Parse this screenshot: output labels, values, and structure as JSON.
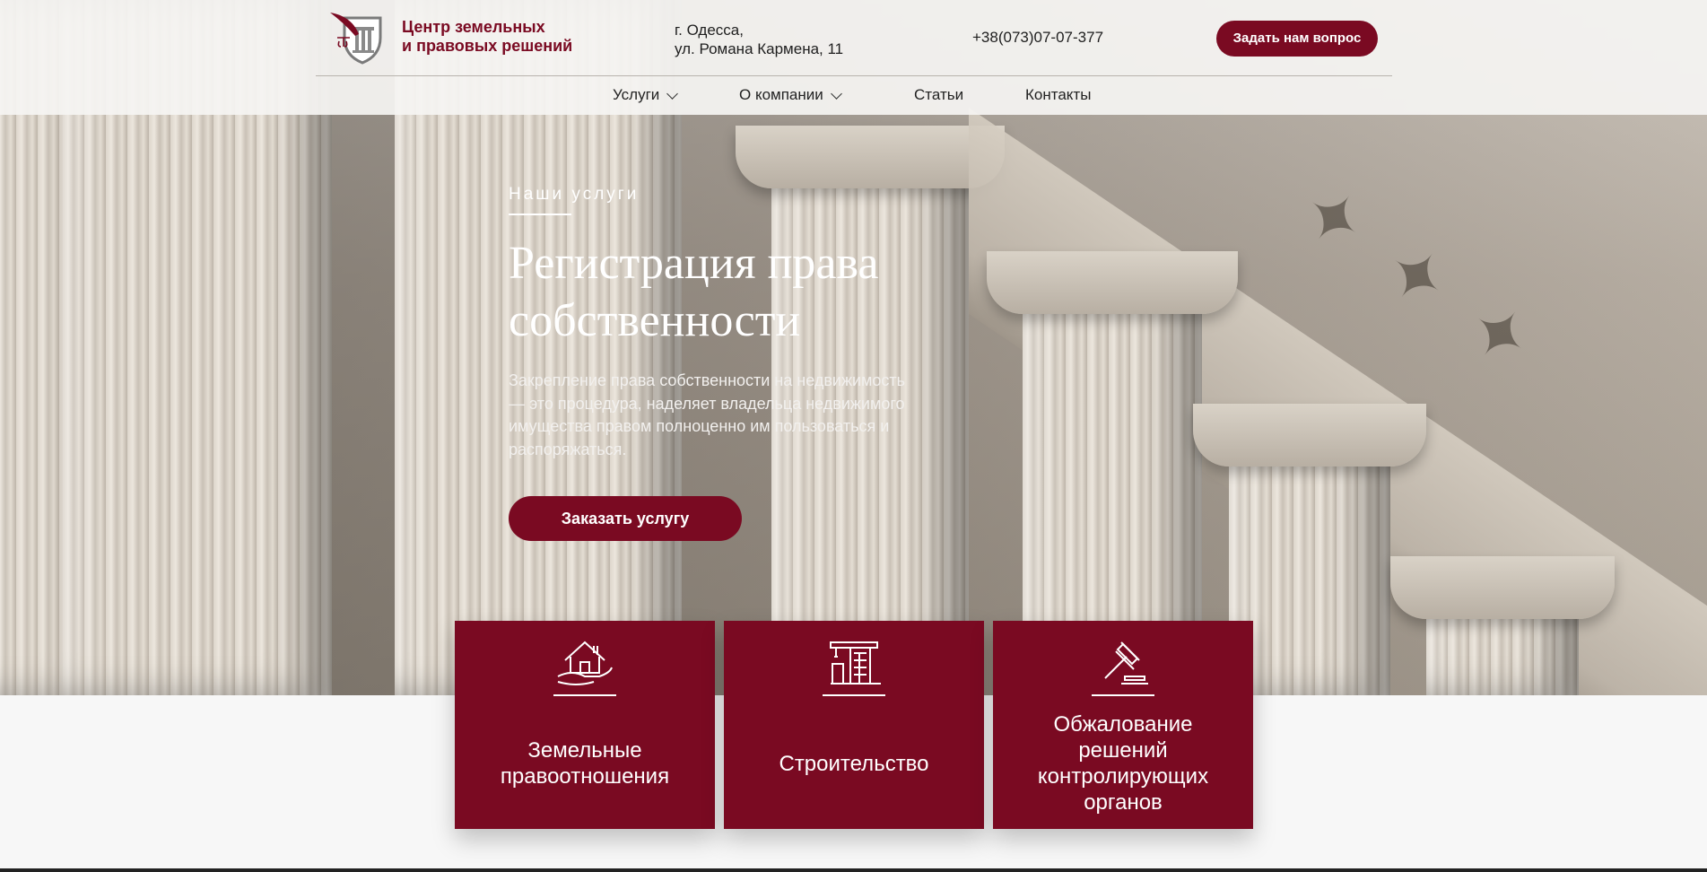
{
  "header": {
    "logo_lines": [
      "Центр земельных",
      "и правовых решений"
    ],
    "address_lines": [
      "г. Одесса,",
      "ул. Романа Кармена, 11"
    ],
    "phone": "+38(073)07-07-377",
    "ask_button": "Задать нам вопрос"
  },
  "nav": {
    "items": [
      {
        "label": "Услуги",
        "has_dropdown": true
      },
      {
        "label": "О компании",
        "has_dropdown": true
      },
      {
        "label": "Статьи",
        "has_dropdown": false
      },
      {
        "label": "Контакты",
        "has_dropdown": false
      }
    ]
  },
  "hero": {
    "eyebrow": "Наши услуги",
    "title_lines": [
      "Регистрация права",
      "собственности"
    ],
    "text_lines": [
      "Закрепление права собственности на недвижимость",
      "— это процедура, наделяет владельца недвижимого",
      "имущества правом полноценно им пользоваться и",
      "распоряжаться."
    ],
    "order_button": "Заказать услугу"
  },
  "services": [
    {
      "icon": "house-hand-icon",
      "title_lines": [
        "Земельные",
        "правоотношения"
      ]
    },
    {
      "icon": "construction-crane-icon",
      "title_lines": [
        "Строительство"
      ]
    },
    {
      "icon": "gavel-icon",
      "title_lines": [
        "Обжалование",
        "решений",
        "контролирующих",
        "органов"
      ]
    }
  ],
  "colors": {
    "accent": "#7a0a22",
    "header_bg": "#f5f4f2",
    "text_dark": "#1e1e1e"
  }
}
